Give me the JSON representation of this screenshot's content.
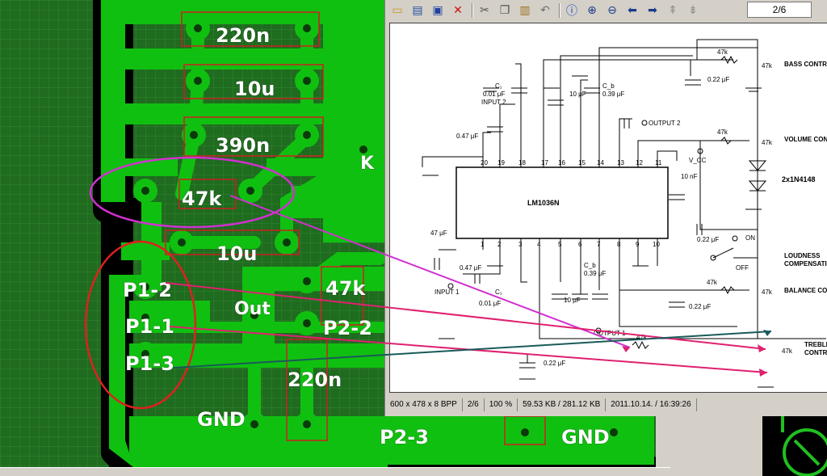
{
  "pcb": {
    "labels": {
      "c1": "220n",
      "c2": "10u",
      "c3": "390n",
      "k": "K",
      "r1": "47k",
      "c4": "10u",
      "r2": "47k",
      "p1_2": "P1-2",
      "p1_1": "P1-1",
      "p1_3": "P1-3",
      "out": "Out",
      "p2_2": "P2-2",
      "c5": "220n",
      "gnd1": "GND",
      "p2_3": "P2-3",
      "gnd2": "GND"
    }
  },
  "viewer": {
    "page_indicator": "2/6",
    "status": {
      "dims": "600 x 478 x 8 BPP",
      "page": "2/6",
      "zoom": "100 %",
      "size": "59.53 KB / 281.12 KB",
      "date": "2011.10.14. / 16:39:26"
    },
    "toolbar_icons": [
      "open-icon",
      "slideshow-icon",
      "save-icon",
      "delete-icon",
      "cut-icon",
      "copy-icon",
      "paste-icon",
      "undo-icon",
      "info-icon",
      "zoom-in-icon",
      "zoom-out-icon",
      "prev-icon",
      "next-icon",
      "first-icon",
      "last-icon"
    ]
  },
  "schematic": {
    "chip": "LM1036N",
    "labels": {
      "c1": "C₁",
      "c1v": "0.01 μF",
      "input2": "INPUT 2",
      "c047a": "0.47 μF",
      "c10a": "10 μF",
      "cb": "C_b",
      "cb039": "0.39 μF",
      "output2": "OUTPUT 2",
      "r47k_bass": "47k",
      "pot_bass": "47k",
      "c022_bass": "0.22 μF",
      "bass": "BASS CONTR",
      "r47k_vol": "47k",
      "pot_vol": "47k",
      "volume": "VOLUME CON",
      "diodes": "2x1N4148",
      "vcc": "V_CC",
      "c10n": "10 nF",
      "c022_on": "0.22 μF",
      "on": "ON",
      "off": "OFF",
      "loudness1": "LOUDNESS",
      "loudness2": "COMPENSATI",
      "c47a": "47 μF",
      "c047b": "0.47 μF",
      "input1": "INPUT 1",
      "c001b": "0.01 μF",
      "c1b": "C₁",
      "cb2": "C_b",
      "cb039b": "0.39 μF",
      "c10b": "10 μF",
      "output1": "OUTPUT 1",
      "r47k_bal": "47k",
      "pot_bal": "47k",
      "c022_bal": "0.22 μF",
      "balance": "BALANCE CO",
      "r47k_treb": "47k",
      "pot_treb": "47k",
      "treble1": "TREBLE",
      "treble2": "CONTRO",
      "c022_treb": "0.22 μF",
      "pins_top": [
        "20",
        "19",
        "18",
        "17",
        "16",
        "15",
        "14",
        "13",
        "12",
        "11"
      ],
      "pins_bot": [
        "1",
        "2",
        "3",
        "4",
        "5",
        "6",
        "7",
        "8",
        "9",
        "10"
      ]
    }
  }
}
